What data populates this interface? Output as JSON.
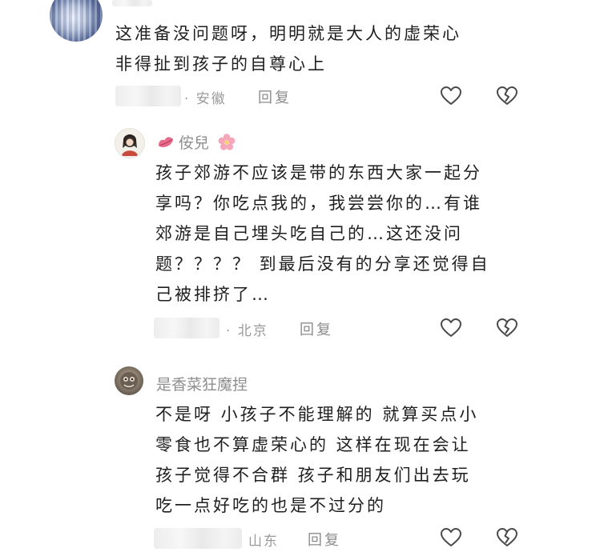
{
  "comments": [
    {
      "lines": [
        "这准备没问题呀，明明就是大人的虚荣心",
        "非得扯到孩子的自尊心上"
      ],
      "location": "· 安徽",
      "reply_label": "回复"
    },
    {
      "username": "侒兒",
      "lines": [
        "孩子郊游不应该是带的东西大家一起分",
        "享吗？你吃点我的，我尝尝你的…有谁",
        "郊游是自己埋头吃自己的…这还没问",
        "题？？？？ 到最后没有的分享还觉得自",
        "己被排挤了…"
      ],
      "location": "· 北京",
      "reply_label": "回复"
    },
    {
      "username": "是香菜狂魔捏",
      "lines": [
        "不是呀 小孩子不能理解的 就算买点小",
        "零食也不算虚荣心的 这样在现在会让",
        "孩子觉得不合群  孩子和朋友们出去玩",
        "吃一点好吃的也是不过分的"
      ],
      "location": "山东",
      "reply_label": "回复"
    }
  ],
  "icons": {
    "like": "heart-outline-icon",
    "dislike": "broken-heart-outline-icon",
    "lips": "lips-emoji-icon",
    "flower": "cherry-blossom-emoji-icon"
  },
  "colors": {
    "text": "#1f1f1f",
    "meta": "#9a9a9a",
    "icon_stroke": "#4a4a4a",
    "lips": "#e86a8a",
    "flower": "#f5a6b9"
  }
}
